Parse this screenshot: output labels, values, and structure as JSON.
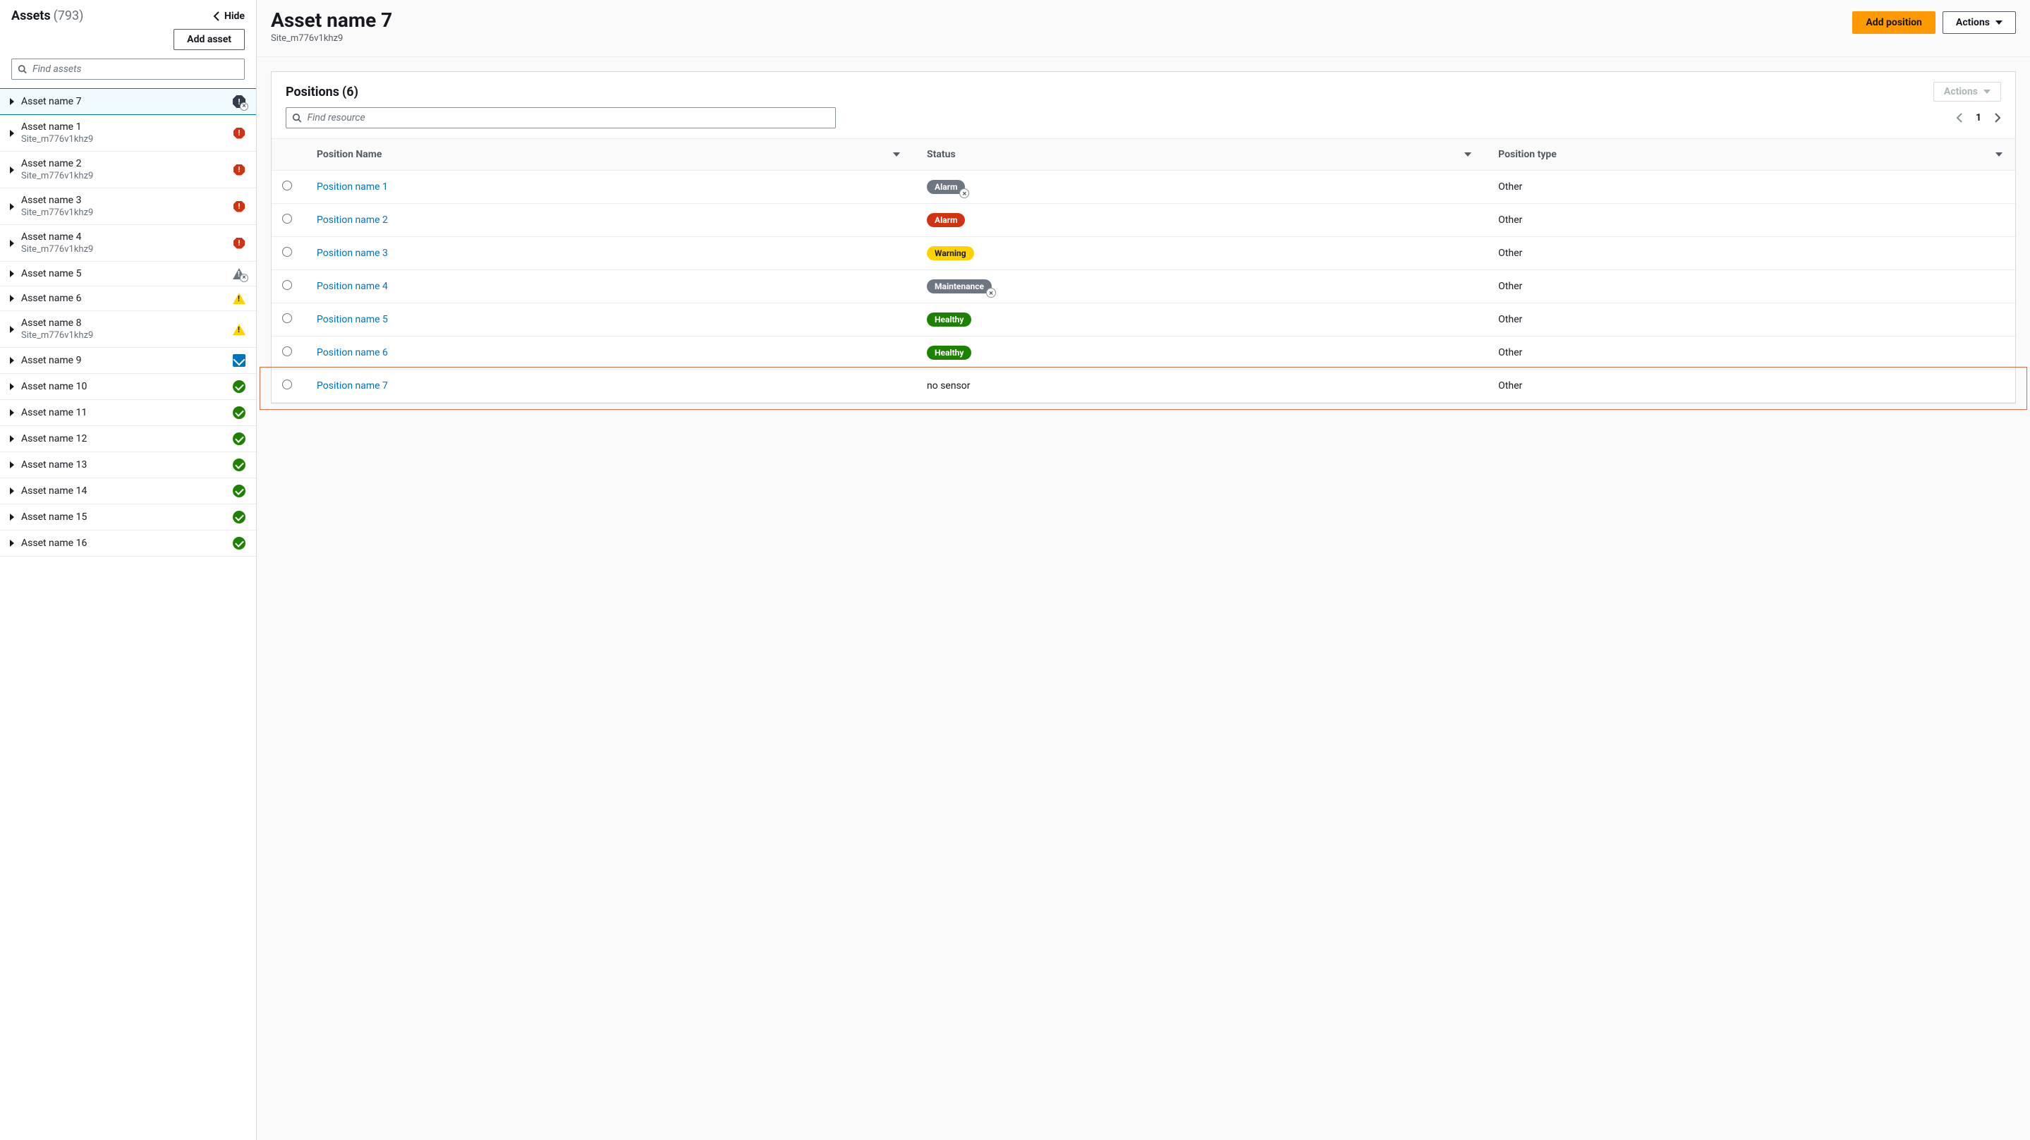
{
  "sidebar": {
    "title": "Assets",
    "count": "(793)",
    "hide_label": "Hide",
    "add_asset_label": "Add asset",
    "search_placeholder": "Find assets",
    "items": [
      {
        "name": "Asset name 7",
        "sub": "",
        "icon": "alarm-mute",
        "selected": true
      },
      {
        "name": "Asset name 1",
        "sub": "Site_m776v1khz9",
        "icon": "alarm"
      },
      {
        "name": "Asset name 2",
        "sub": "Site_m776v1khz9",
        "icon": "alarm"
      },
      {
        "name": "Asset name 3",
        "sub": "Site_m776v1khz9",
        "icon": "alarm"
      },
      {
        "name": "Asset name 4",
        "sub": "Site_m776v1khz9",
        "icon": "alarm"
      },
      {
        "name": "Asset name 5",
        "sub": "",
        "icon": "warn-mute"
      },
      {
        "name": "Asset name 6",
        "sub": "",
        "icon": "warn"
      },
      {
        "name": "Asset name 8",
        "sub": "Site_m776v1khz9",
        "icon": "warn"
      },
      {
        "name": "Asset name 9",
        "sub": "",
        "icon": "maint"
      },
      {
        "name": "Asset name 10",
        "sub": "",
        "icon": "ok"
      },
      {
        "name": "Asset name 11",
        "sub": "",
        "icon": "ok"
      },
      {
        "name": "Asset name 12",
        "sub": "",
        "icon": "ok"
      },
      {
        "name": "Asset name 13",
        "sub": "",
        "icon": "ok"
      },
      {
        "name": "Asset name 14",
        "sub": "",
        "icon": "ok"
      },
      {
        "name": "Asset name 15",
        "sub": "",
        "icon": "ok"
      },
      {
        "name": "Asset name 16",
        "sub": "",
        "icon": "ok"
      }
    ]
  },
  "header": {
    "title": "Asset name 7",
    "subtitle": "Site_m776v1khz9",
    "add_position_label": "Add position",
    "actions_label": "Actions"
  },
  "panel": {
    "title": "Positions",
    "count": "(6)",
    "actions_label": "Actions",
    "search_placeholder": "Find resource",
    "page": "1",
    "columns": {
      "name": "Position Name",
      "status": "Status",
      "type": "Position type"
    },
    "rows": [
      {
        "name": "Position name 1",
        "status": "Alarm",
        "status_kind": "alarm-mute",
        "type": "Other"
      },
      {
        "name": "Position name 2",
        "status": "Alarm",
        "status_kind": "alarm",
        "type": "Other"
      },
      {
        "name": "Position name 3",
        "status": "Warning",
        "status_kind": "warning",
        "type": "Other"
      },
      {
        "name": "Position name 4",
        "status": "Maintenance",
        "status_kind": "maintenance-mute",
        "type": "Other"
      },
      {
        "name": "Position name 5",
        "status": "Healthy",
        "status_kind": "healthy",
        "type": "Other"
      },
      {
        "name": "Position name 6",
        "status": "Healthy",
        "status_kind": "healthy",
        "type": "Other"
      },
      {
        "name": "Position name 7",
        "status": "no sensor",
        "status_kind": "nosensor",
        "type": "Other",
        "highlight": true
      }
    ]
  }
}
